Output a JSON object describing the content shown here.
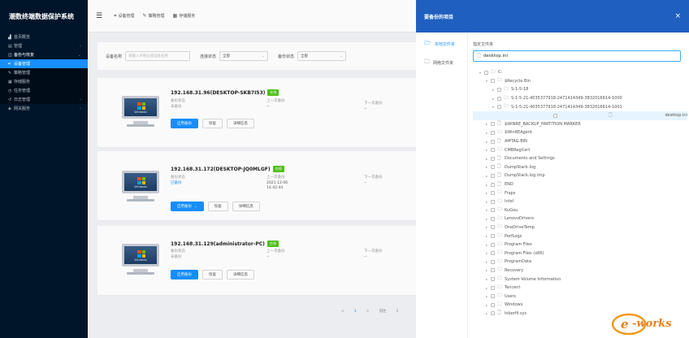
{
  "app": {
    "title": "潮数终端数据保护系统"
  },
  "sidebar": {
    "items": [
      {
        "label": "首页概览",
        "icon": "chart-icon"
      },
      {
        "label": "管理",
        "icon": "list-icon"
      },
      {
        "label": "备份与恢复",
        "icon": "backup-icon"
      },
      {
        "label": "设备管理",
        "icon": "device-icon"
      },
      {
        "label": "策略管理",
        "icon": "policy-icon"
      },
      {
        "label": "存储服务",
        "icon": "storage-icon"
      },
      {
        "label": "任务管理",
        "icon": "task-icon"
      },
      {
        "label": "日志管理",
        "icon": "log-icon"
      },
      {
        "label": "网关服务",
        "icon": "gateway-icon"
      }
    ]
  },
  "topbar": {
    "tabs": [
      {
        "label": "设备管理"
      },
      {
        "label": "策略管理"
      },
      {
        "label": "存储服务"
      }
    ]
  },
  "filters": {
    "name_label": "设备名称",
    "name_placeholder": "请输入IP地址或设备名称",
    "link_label": "连接状态",
    "link_value": "全部",
    "backup_label": "备份状态",
    "backup_value": "全部"
  },
  "devices": [
    {
      "host": "192.168.31.96(DESKTOP-SKB7I53)",
      "status": "在线",
      "backup_state_label": "备份状态",
      "backup_state": "未备份",
      "last_label": "上一次备份",
      "last_value": "--",
      "next_label": "下一次备份",
      "next_value": "--",
      "btn_primary": "启用备份",
      "btn_second": "恢复",
      "btn_third": "详细信息"
    },
    {
      "host": "192.168.31.172(DESKTOP-JQ0MLGF)",
      "status": "在线",
      "backup_state_label": "备份状态",
      "backup_state": "已备份",
      "last_label": "上一次备份",
      "last_value": "2021-12-06",
      "last_time": "14:42:44",
      "next_label": "下一次备份",
      "next_value": "--",
      "btn_primary": "启用备份",
      "btn_second": "恢复",
      "btn_third": "详细信息"
    },
    {
      "host": "192.168.31.129(administrator-PC)",
      "status": "在线",
      "backup_state_label": "备份状态",
      "backup_state": "未备份",
      "last_label": "上一次备份",
      "last_value": "--",
      "next_label": "下一次备份",
      "next_value": "--",
      "btn_primary": "启用备份",
      "btn_second": "恢复",
      "btn_third": "详细信息"
    }
  ],
  "pager": {
    "prev": "<",
    "page": "1",
    "next": ">",
    "goto": "前往",
    "page_num": "1"
  },
  "drawer": {
    "title": "要备份的项目",
    "close": "×",
    "sources": [
      "本地文件夹",
      "网络文件夹"
    ],
    "path_label": "指定文件夹",
    "path_value": "desktop.ini",
    "tree": [
      {
        "label": "C:",
        "level": 0,
        "type": "folder",
        "expanded": true
      },
      {
        "label": "$Recycle.Bin",
        "level": 1,
        "type": "folder",
        "expanded": true
      },
      {
        "label": "S-1-5-18",
        "level": 2,
        "type": "folder"
      },
      {
        "label": "S-1-5-21-4035377918-2471414349-3832016614-1000",
        "level": 2,
        "type": "folder"
      },
      {
        "label": "S-1-5-21-4035377918-2471414349-3832016614-1001",
        "level": 2,
        "type": "folder",
        "expanded": true
      },
      {
        "label": "desktop.ini",
        "level": 3,
        "type": "file",
        "selected": true
      },
      {
        "label": "$WINRE_BACKUP_PARTITION.MARKER",
        "level": 1,
        "type": "file"
      },
      {
        "label": "$WinREAgent",
        "level": 1,
        "type": "folder"
      },
      {
        "label": "AMTAG.BIN",
        "level": 1,
        "type": "file"
      },
      {
        "label": "CMBRegCert",
        "level": 1,
        "type": "folder"
      },
      {
        "label": "Documents and Settings",
        "level": 1,
        "type": "file"
      },
      {
        "label": "DumpStack.log",
        "level": 1,
        "type": "file"
      },
      {
        "label": "DumpStack.log.tmp",
        "level": 1,
        "type": "file"
      },
      {
        "label": "END",
        "level": 1,
        "type": "file"
      },
      {
        "label": "Fraps",
        "level": 1,
        "type": "folder"
      },
      {
        "label": "Intel",
        "level": 1,
        "type": "folder"
      },
      {
        "label": "KuGou",
        "level": 1,
        "type": "folder"
      },
      {
        "label": "LenovoDrivers",
        "level": 1,
        "type": "folder"
      },
      {
        "label": "OneDriveTemp",
        "level": 1,
        "type": "folder"
      },
      {
        "label": "PerfLogs",
        "level": 1,
        "type": "folder"
      },
      {
        "label": "Program Files",
        "level": 1,
        "type": "folder"
      },
      {
        "label": "Program Files (x86)",
        "level": 1,
        "type": "folder"
      },
      {
        "label": "ProgramData",
        "level": 1,
        "type": "folder"
      },
      {
        "label": "Recovery",
        "level": 1,
        "type": "folder"
      },
      {
        "label": "System Volume Information",
        "level": 1,
        "type": "folder"
      },
      {
        "label": "Tencent",
        "level": 1,
        "type": "folder"
      },
      {
        "label": "Users",
        "level": 1,
        "type": "folder"
      },
      {
        "label": "Windows",
        "level": 1,
        "type": "folder"
      },
      {
        "label": "hiberfil.sys",
        "level": 1,
        "type": "file"
      }
    ]
  },
  "watermark": {
    "text": "e-works"
  },
  "colors": {
    "sidebar": "#001529",
    "accent": "#1890ff",
    "drawer_header": "#1f5fbf",
    "online": "#52c41a"
  }
}
